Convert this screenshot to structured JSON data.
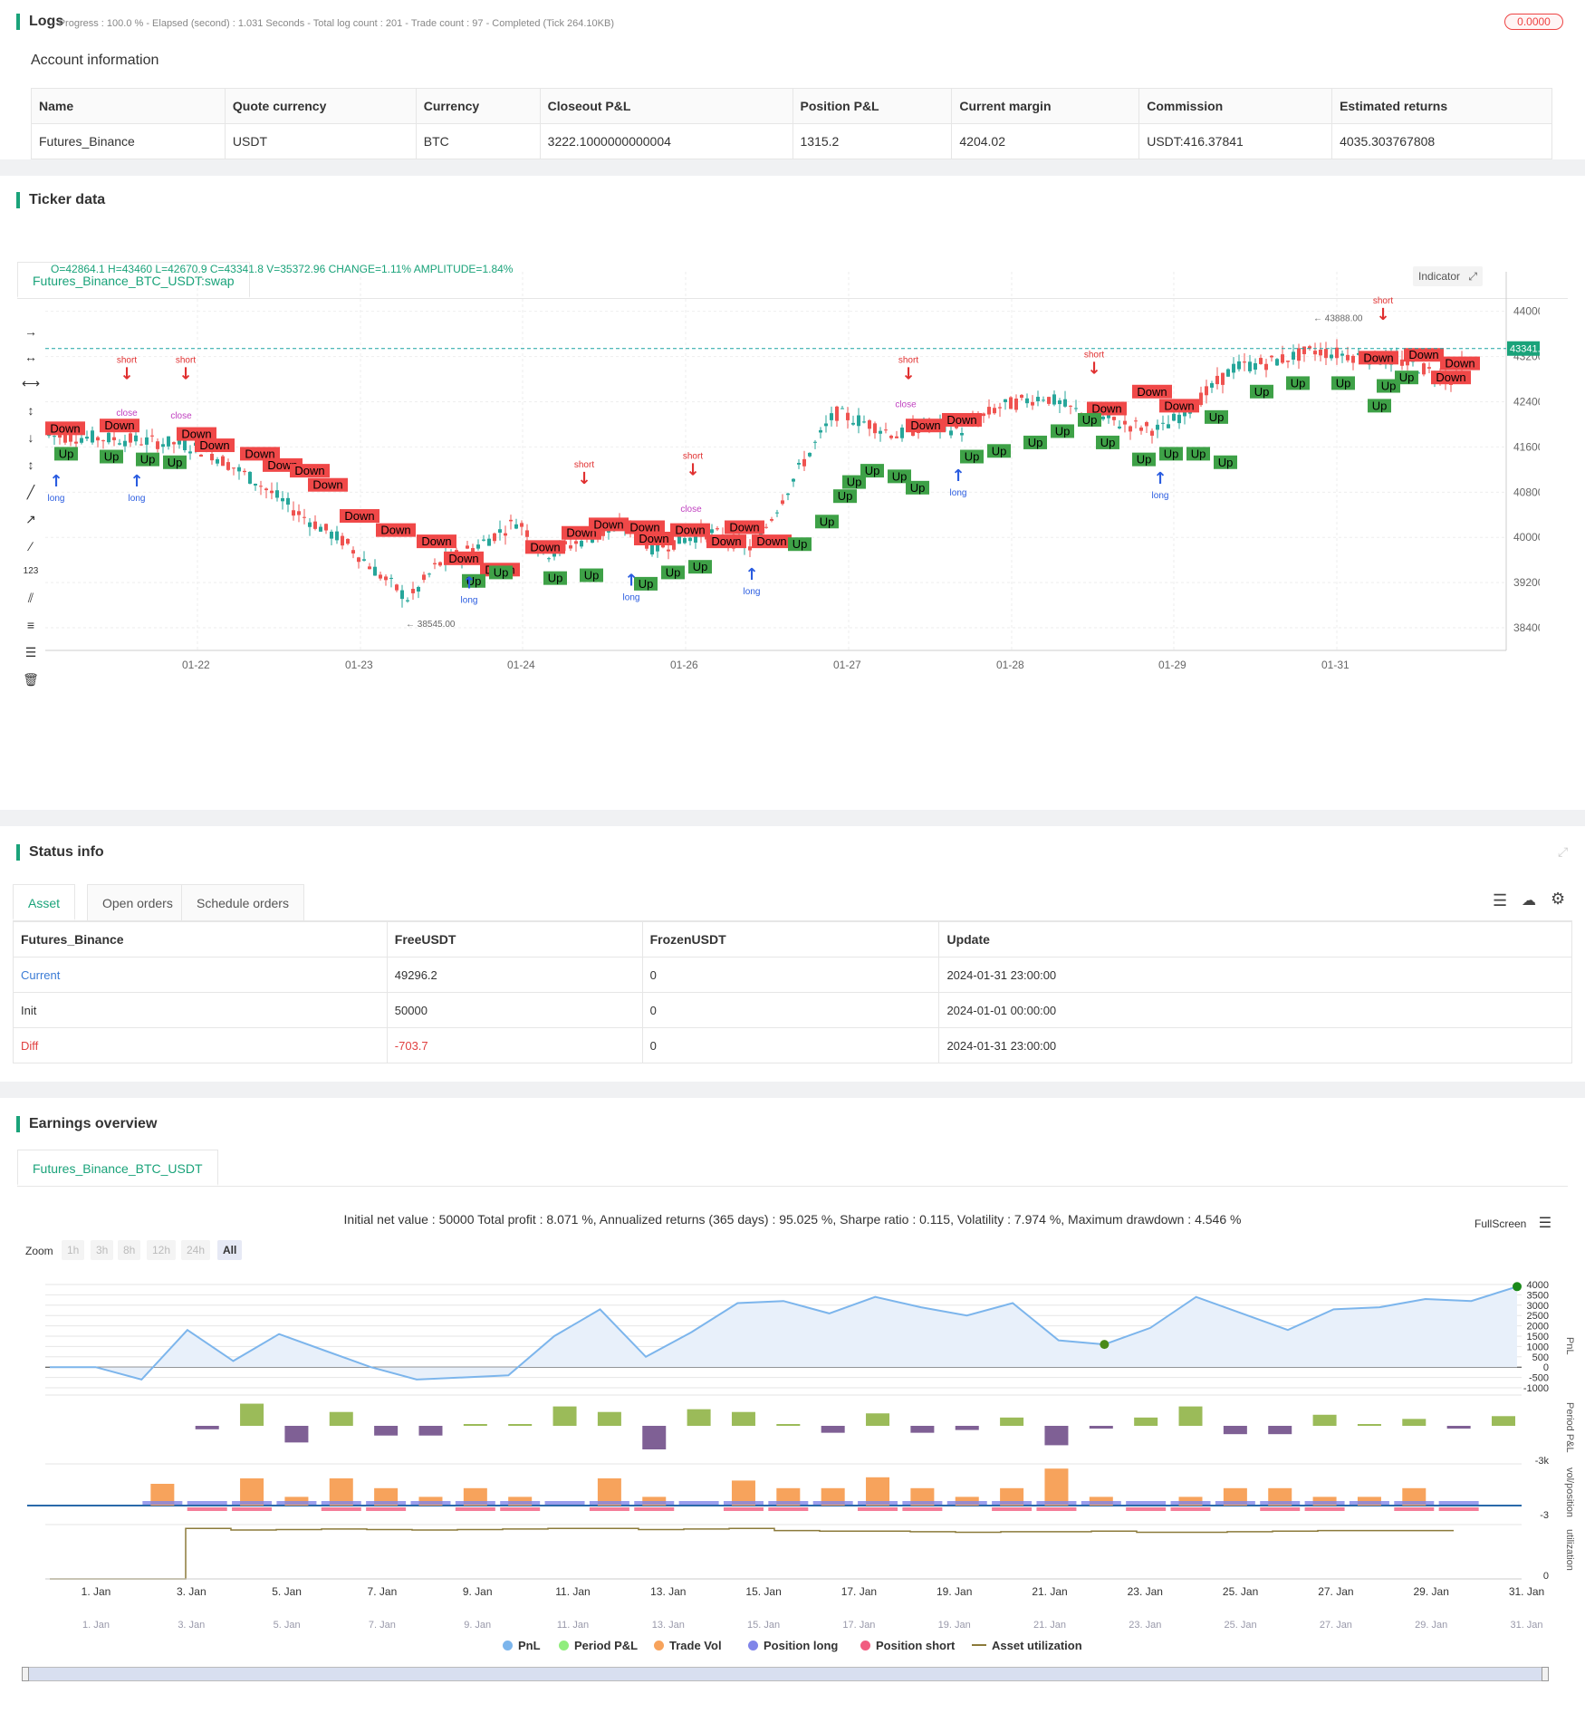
{
  "logs": {
    "title": "Logs",
    "status_line": "- Progress : 100.0 % - Elapsed (second) : 1.031  Seconds - Total log count : 201 - Trade count : 97 - Completed (Tick 264.10KB)",
    "badge": "0.0000"
  },
  "account": {
    "heading": "Account information",
    "columns": [
      "Name",
      "Quote currency",
      "Currency",
      "Closeout P&L",
      "Position P&L",
      "Current margin",
      "Commission",
      "Estimated returns"
    ],
    "row": [
      "Futures_Binance",
      "USDT",
      "BTC",
      "3222.1000000000004",
      "1315.2",
      "4204.02",
      "USDT:416.37841",
      "4035.303767808"
    ]
  },
  "ticker": {
    "title": "Ticker data",
    "tab": "Futures_Binance_BTC_USDT:swap",
    "ohlc": "O=42864.1 H=43460 L=42670.9 C=43341.8 V=35372.96 CHANGE=1.11% AMPLITUDE=1.84%",
    "indicator_label": "Indicator",
    "price_tag": "43341.80",
    "price_axis": [
      "44000.00",
      "43200.00",
      "42400.00",
      "41600.00",
      "40800.00",
      "40000.00",
      "39200.00",
      "38400.00"
    ],
    "date_axis": [
      "01-22",
      "01-23",
      "01-24",
      "01-26",
      "01-27",
      "01-28",
      "01-29",
      "01-31"
    ],
    "high_note": "43888.00",
    "low_note": "38545.00",
    "signal_labels": {
      "up": "Up",
      "down": "Down",
      "long": "long",
      "short": "short",
      "close": "close",
      "Long": "Long",
      "Short": "Short",
      "qty": "1"
    },
    "colors": {
      "up": "#3ea147",
      "down": "#f04848",
      "candle_up": "#26a69a",
      "candle_down": "#ef5350",
      "long_arrow": "#2a5ce0",
      "short_arrow": "#e03030"
    }
  },
  "status": {
    "title": "Status info",
    "tabs": [
      "Asset",
      "Open orders",
      "Schedule orders"
    ],
    "columns": [
      "Futures_Binance",
      "FreeUSDT",
      "FrozenUSDT",
      "Update"
    ],
    "rows": [
      [
        "Current",
        "49296.2",
        "0",
        "2024-01-31 23:00:00"
      ],
      [
        "Init",
        "50000",
        "0",
        "2024-01-01 00:00:00"
      ],
      [
        "Diff",
        "-703.7",
        "0",
        "2024-01-31 23:00:00"
      ]
    ]
  },
  "earnings": {
    "title": "Earnings overview",
    "tab": "Futures_Binance_BTC_USDT",
    "summary": "Initial net value : 50000 Total profit : 8.071 %, Annualized returns (365 days) : 95.025 %, Sharpe ratio : 0.115, Volatility : 7.974 %, Maximum drawdown : 4.546 %",
    "fullscreen": "FullScreen",
    "zoom_label": "Zoom",
    "zoom_buttons": [
      "1h",
      "3h",
      "8h",
      "12h",
      "24h",
      "All"
    ],
    "pnl_axis": [
      "4000",
      "3500",
      "3000",
      "2500",
      "2000",
      "1500",
      "1000",
      "500",
      "0",
      "-500",
      "-1000"
    ],
    "axis_titles": {
      "pnl": "PnL",
      "period": "Period P&L",
      "vol": "vol/position",
      "util": "utilization"
    },
    "period_tick": "-3k",
    "vol_tick": "-3",
    "util_tick": "0",
    "x_axis": [
      "1. Jan",
      "3. Jan",
      "5. Jan",
      "7. Jan",
      "9. Jan",
      "11. Jan",
      "13. Jan",
      "15. Jan",
      "17. Jan",
      "19. Jan",
      "21. Jan",
      "23. Jan",
      "25. Jan",
      "27. Jan",
      "29. Jan",
      "31. Jan"
    ],
    "legend": [
      "PnL",
      "Period P&L",
      "Trade Vol",
      "Position long",
      "Position short",
      "Asset utilization"
    ],
    "legend_colors": [
      "#7cb5ec",
      "#90ed7d",
      "#f7a35c",
      "#8085e9",
      "#f15c80",
      "#8b7a3a"
    ],
    "pnl_series": [
      0,
      0,
      -600,
      1800,
      300,
      1600,
      800,
      0,
      -600,
      -500,
      -400,
      1500,
      2800,
      500,
      1700,
      3100,
      3200,
      2600,
      3400,
      2900,
      2500,
      3100,
      1300,
      1100,
      1900,
      3400,
      2600,
      1800,
      2800,
      2900,
      3300,
      3200,
      3900
    ],
    "period_series": [
      0,
      0,
      -250,
      1600,
      -1200,
      1000,
      -700,
      -700,
      40,
      40,
      1400,
      1000,
      -1700,
      1200,
      1000,
      100,
      -500,
      900,
      -500,
      -300,
      600,
      -1400,
      -200,
      600,
      1400,
      -600,
      -600,
      800,
      50,
      500,
      -200,
      700
    ],
    "vol_series": [
      0,
      2,
      0,
      2.5,
      0.8,
      2.5,
      1.6,
      0.8,
      1.6,
      0.8,
      0,
      2.5,
      0.8,
      0,
      2.3,
      1.6,
      1.6,
      2.6,
      1.6,
      0.8,
      1.6,
      3.4,
      0.8,
      0,
      0.8,
      1.6,
      1.6,
      0.8,
      0.8,
      1.6,
      0,
      0
    ],
    "util_series": [
      0,
      0,
      0,
      0.9,
      0.87,
      0.88,
      0.89,
      0.88,
      0.87,
      0.88,
      0.89,
      0.9,
      0.9,
      0.88,
      0.89,
      0.9,
      0.86,
      0.85,
      0.85,
      0.84,
      0.83,
      0.84,
      0.84,
      0.85,
      0.83,
      0.83,
      0.84,
      0.85,
      0.86,
      0.86,
      0.86,
      0.86
    ]
  }
}
